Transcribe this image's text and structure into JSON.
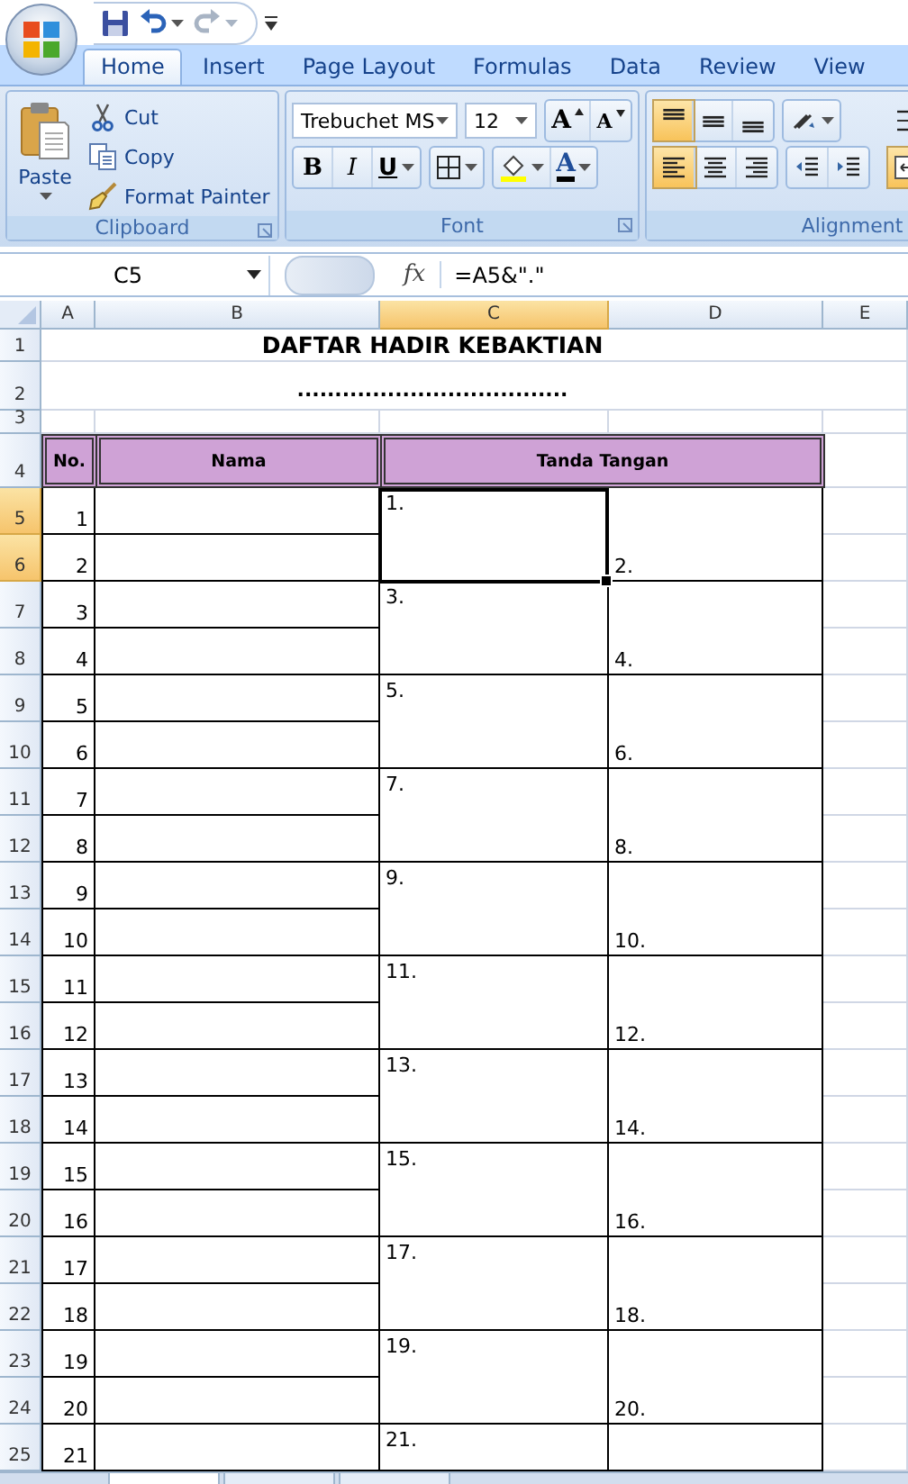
{
  "quick_access": [
    {
      "kind": "save",
      "disabled": false
    },
    {
      "kind": "undo",
      "disabled": false
    },
    {
      "kind": "redo",
      "disabled": true
    }
  ],
  "tabs": [
    {
      "label": "Home",
      "selected": true
    },
    {
      "label": "Insert",
      "selected": false
    },
    {
      "label": "Page Layout",
      "selected": false
    },
    {
      "label": "Formulas",
      "selected": false
    },
    {
      "label": "Data",
      "selected": false
    },
    {
      "label": "Review",
      "selected": false
    },
    {
      "label": "View",
      "selected": false
    }
  ],
  "clipboard": {
    "paste": "Paste",
    "label": "Clipboard",
    "actions": [
      {
        "kind": "cut",
        "label": "Cut"
      },
      {
        "kind": "copy",
        "label": "Copy"
      },
      {
        "kind": "format-painter",
        "label": "Format Painter"
      }
    ]
  },
  "font": {
    "name": "Trebuchet MS",
    "size": "12",
    "grow": "A",
    "shrink": "A",
    "styles": [
      "B",
      "I",
      "U"
    ],
    "color_button": "A",
    "label": "Font"
  },
  "alignment": {
    "label": "Alignment",
    "top_row": [
      {
        "kind": "align-top",
        "selected": true
      },
      {
        "kind": "align-middle",
        "selected": false
      },
      {
        "kind": "align-bottom",
        "selected": false
      },
      {
        "kind": "orientation",
        "selected": false
      }
    ],
    "bottom_row": [
      {
        "kind": "align-left",
        "selected": true
      },
      {
        "kind": "align-center",
        "selected": false
      },
      {
        "kind": "align-right",
        "selected": false
      },
      {
        "kind": "indent-decrease",
        "selected": false
      },
      {
        "kind": "indent-increase",
        "selected": false
      }
    ],
    "side": [
      {
        "kind": "wrap",
        "selected": false
      },
      {
        "kind": "merge",
        "selected": true
      }
    ]
  },
  "formula_bar": {
    "name_box": "C5",
    "fx": "fx",
    "formula": "=A5&\".\""
  },
  "columns": [
    {
      "label": "A",
      "selected": false
    },
    {
      "label": "B",
      "selected": false
    },
    {
      "label": "C",
      "selected": true
    },
    {
      "label": "D",
      "selected": false
    },
    {
      "label": "E",
      "selected": false
    }
  ],
  "row_headers": [
    {
      "label": "1",
      "selected": false
    },
    {
      "label": "2",
      "selected": false
    },
    {
      "label": "3",
      "selected": false
    },
    {
      "label": "4",
      "selected": false
    },
    {
      "label": "5",
      "selected": true
    },
    {
      "label": "6",
      "selected": true
    },
    {
      "label": "7",
      "selected": false
    },
    {
      "label": "8",
      "selected": false
    },
    {
      "label": "9",
      "selected": false
    },
    {
      "label": "10",
      "selected": false
    },
    {
      "label": "11",
      "selected": false
    },
    {
      "label": "12",
      "selected": false
    },
    {
      "label": "13",
      "selected": false
    },
    {
      "label": "14",
      "selected": false
    },
    {
      "label": "15",
      "selected": false
    },
    {
      "label": "16",
      "selected": false
    },
    {
      "label": "17",
      "selected": false
    },
    {
      "label": "18",
      "selected": false
    },
    {
      "label": "19",
      "selected": false
    },
    {
      "label": "20",
      "selected": false
    },
    {
      "label": "21",
      "selected": false
    },
    {
      "label": "22",
      "selected": false
    },
    {
      "label": "23",
      "selected": false
    },
    {
      "label": "24",
      "selected": false
    },
    {
      "label": "25",
      "selected": false
    }
  ],
  "sheet": {
    "title": "DAFTAR HADIR KEBAKTIAN",
    "subtitle": "....................................",
    "headers": [
      "No.",
      "Nama",
      "Tanda Tangan"
    ],
    "numbers": [
      "1",
      "2",
      "3",
      "4",
      "5",
      "6",
      "7",
      "8",
      "9",
      "10",
      "11",
      "12",
      "13",
      "14",
      "15",
      "16",
      "17",
      "18",
      "19",
      "20",
      "21"
    ],
    "signatures": [
      {
        "first": "1.",
        "second": "2.",
        "selected": true
      },
      {
        "first": "3.",
        "second": "4.",
        "selected": false
      },
      {
        "first": "5.",
        "second": "6.",
        "selected": false
      },
      {
        "first": "7.",
        "second": "8.",
        "selected": false
      },
      {
        "first": "9.",
        "second": "10.",
        "selected": false
      },
      {
        "first": "11.",
        "second": "12.",
        "selected": false
      },
      {
        "first": "13.",
        "second": "14.",
        "selected": false
      },
      {
        "first": "15.",
        "second": "16.",
        "selected": false
      },
      {
        "first": "17.",
        "second": "18.",
        "selected": false
      },
      {
        "first": "19.",
        "second": "20.",
        "selected": false
      },
      {
        "first": "21.",
        "selected": false
      }
    ]
  }
}
